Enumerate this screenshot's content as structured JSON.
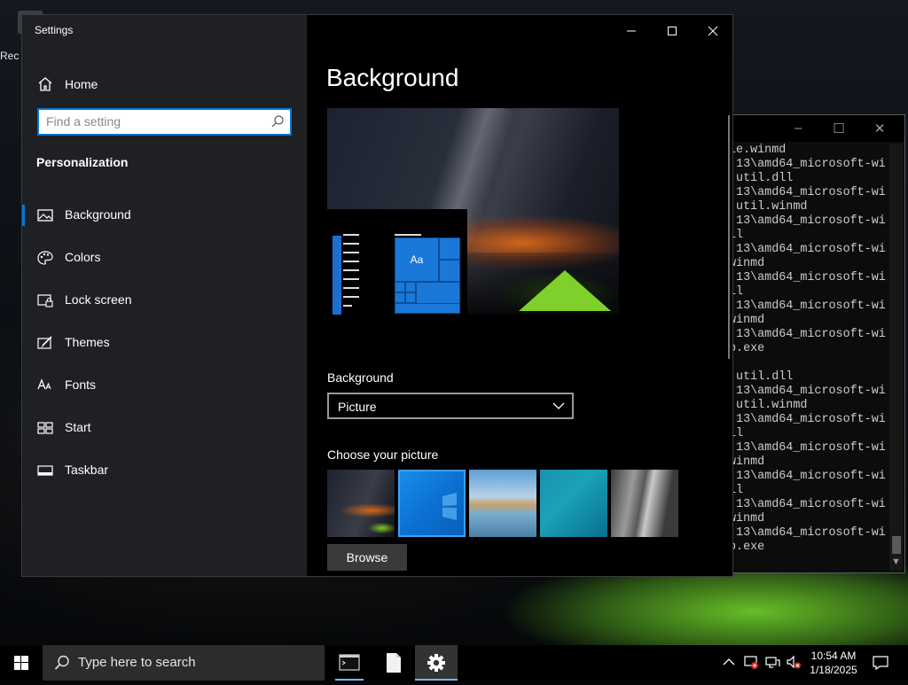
{
  "desktop": {
    "icon_label": "Rec"
  },
  "console": {
    "lines": [
      "le.winmd",
      ".13\\amd64_microsoft-wi",
      ".util.dll",
      ".13\\amd64_microsoft-wi",
      ".util.winmd",
      ".13\\amd64_microsoft-wi",
      "ll",
      ".13\\amd64_microsoft-wi",
      "winmd",
      ".13\\amd64_microsoft-wi",
      "ll",
      ".13\\amd64_microsoft-wi",
      "winmd",
      ".13\\amd64_microsoft-wi",
      "p.exe",
      "",
      ".util.dll",
      ".13\\amd64_microsoft-wi",
      ".util.winmd",
      ".13\\amd64_microsoft-wi",
      "ll",
      ".13\\amd64_microsoft-wi",
      "winmd",
      ".13\\amd64_microsoft-wi",
      "ll",
      ".13\\amd64_microsoft-wi",
      "winmd",
      ".13\\amd64_microsoft-wi",
      "p.exe"
    ]
  },
  "settings": {
    "app_title": "Settings",
    "home_label": "Home",
    "search_placeholder": "Find a setting",
    "section_title": "Personalization",
    "nav_items": [
      {
        "label": "Background",
        "icon": "picture-icon",
        "active": true
      },
      {
        "label": "Colors",
        "icon": "palette-icon",
        "active": false
      },
      {
        "label": "Lock screen",
        "icon": "lock-screen-icon",
        "active": false
      },
      {
        "label": "Themes",
        "icon": "brush-icon",
        "active": false
      },
      {
        "label": "Fonts",
        "icon": "font-icon",
        "active": false
      },
      {
        "label": "Start",
        "icon": "start-icon",
        "active": false
      },
      {
        "label": "Taskbar",
        "icon": "taskbar-icon",
        "active": false
      }
    ],
    "page_title": "Background",
    "preview_tile_text": "Aa",
    "background_label": "Background",
    "background_value": "Picture",
    "choose_picture_label": "Choose your picture",
    "browse_label": "Browse",
    "accent_color": "#0078d7"
  },
  "taskbar": {
    "search_label": "Type here to search",
    "time": "10:54 AM",
    "date": "1/18/2025",
    "apps": [
      "command-prompt-icon",
      "file-icon",
      "settings-gear-icon"
    ]
  }
}
